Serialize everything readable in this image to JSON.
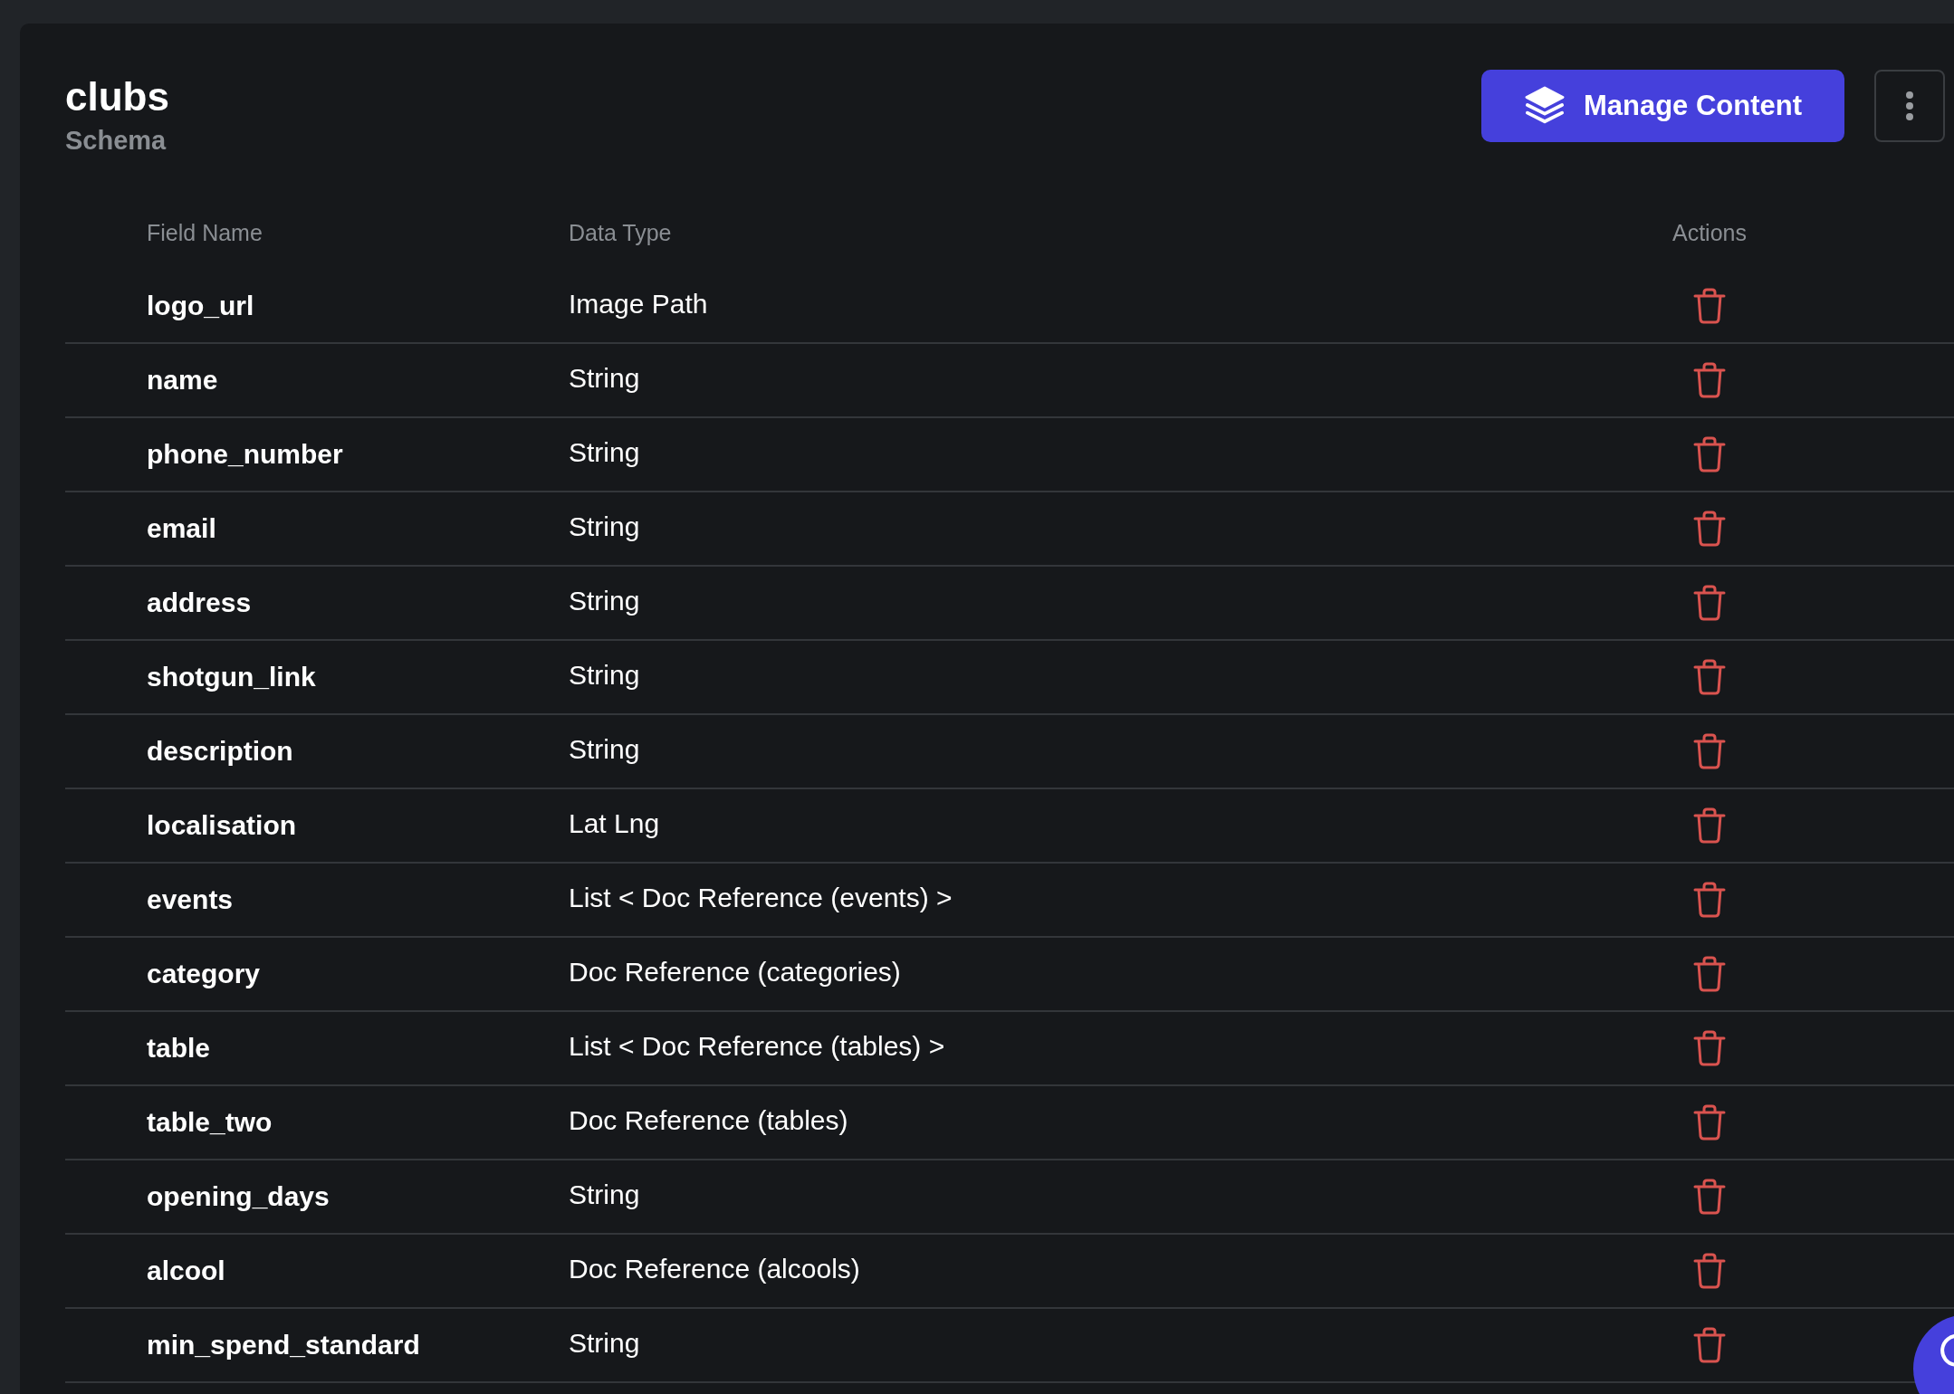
{
  "header": {
    "title": "clubs",
    "subtitle": "Schema",
    "primary_button": "Manage Content"
  },
  "table": {
    "columns": [
      "Field Name",
      "Data Type",
      "Actions"
    ],
    "rows": [
      {
        "field_name": "logo_url",
        "data_type": "Image Path"
      },
      {
        "field_name": "name",
        "data_type": "String"
      },
      {
        "field_name": "phone_number",
        "data_type": "String"
      },
      {
        "field_name": "email",
        "data_type": "String"
      },
      {
        "field_name": "address",
        "data_type": "String"
      },
      {
        "field_name": "shotgun_link",
        "data_type": "String"
      },
      {
        "field_name": "description",
        "data_type": "String"
      },
      {
        "field_name": "localisation",
        "data_type": "Lat Lng"
      },
      {
        "field_name": "events",
        "data_type": "List < Doc Reference (events) >"
      },
      {
        "field_name": "category",
        "data_type": "Doc Reference (categories)"
      },
      {
        "field_name": "table",
        "data_type": "List < Doc Reference (tables) >"
      },
      {
        "field_name": "table_two",
        "data_type": "Doc Reference (tables)"
      },
      {
        "field_name": "opening_days",
        "data_type": "String"
      },
      {
        "field_name": "alcool",
        "data_type": "Doc Reference (alcools)"
      },
      {
        "field_name": "min_spend_standard",
        "data_type": "String"
      }
    ]
  }
}
